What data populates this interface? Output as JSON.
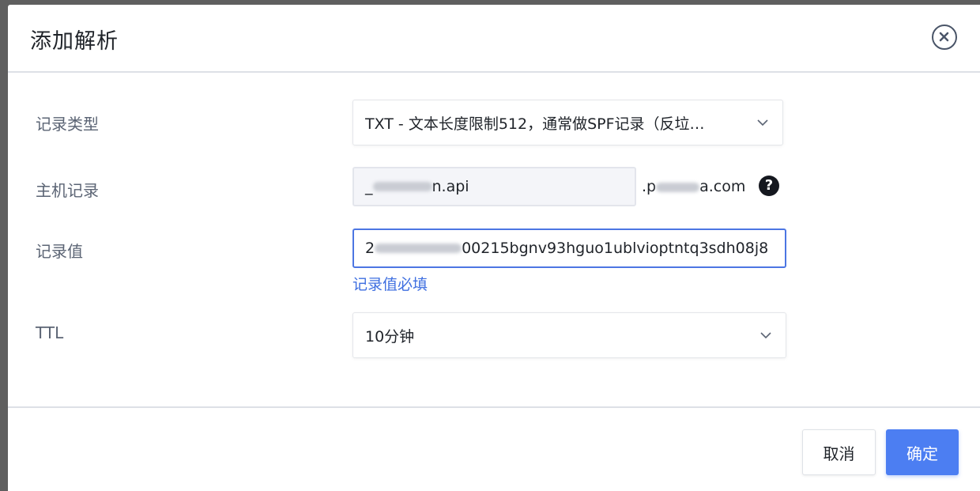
{
  "dialog": {
    "title": "添加解析",
    "close_icon": "close-circle-icon"
  },
  "form": {
    "record_type": {
      "label": "记录类型",
      "value": "TXT - 文本长度限制512，通常做SPF记录（反垃…"
    },
    "host": {
      "label": "主机记录",
      "value_prefix": "_",
      "value_suffix": "n.api",
      "domain_prefix": ".p",
      "domain_suffix": "a.com",
      "help_icon": "question-circle-icon"
    },
    "record_value": {
      "label": "记录值",
      "value_start": "2",
      "value_end": "00215bgnv93hguo1ublvioptntq3sdh08j8",
      "error": "记录值必填"
    },
    "ttl": {
      "label": "TTL",
      "value": "10分钟"
    }
  },
  "footer": {
    "cancel_label": "取消",
    "confirm_label": "确定"
  },
  "colors": {
    "primary": "#4c7ef2",
    "error_text": "#3f6fe0",
    "active_border": "#4c76e3"
  }
}
